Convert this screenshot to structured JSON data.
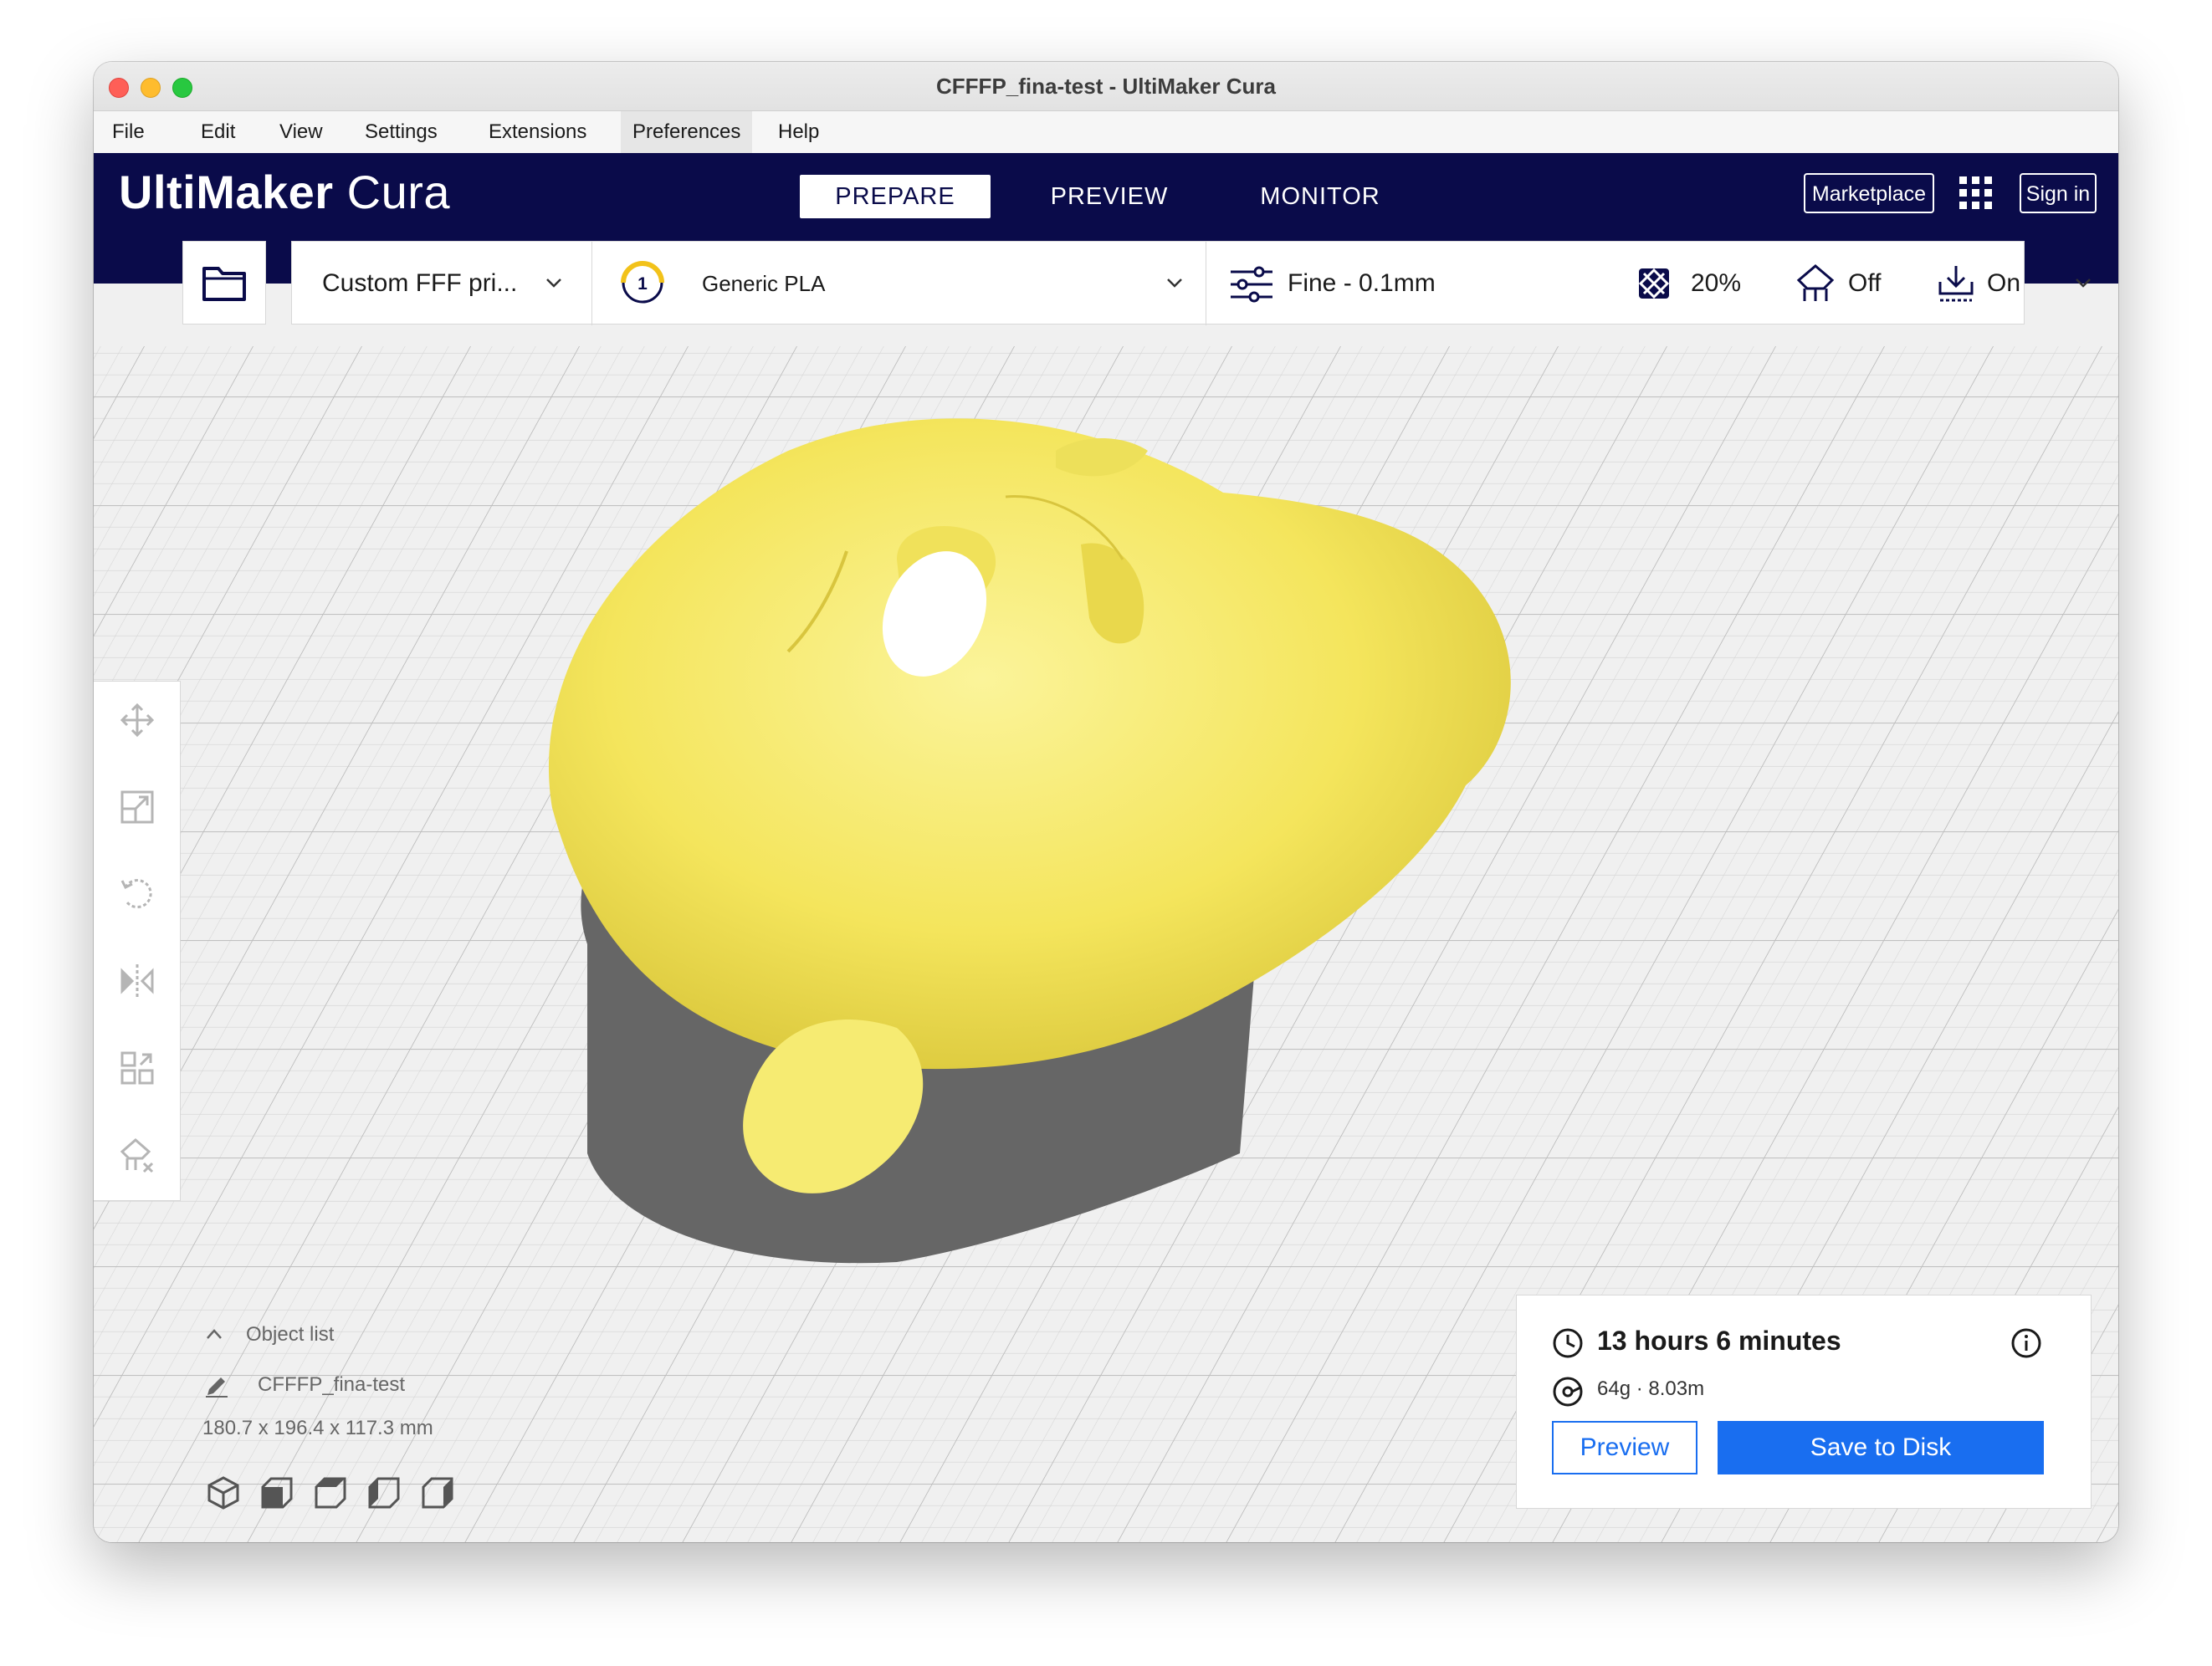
{
  "window": {
    "title": "CFFFP_fina-test - UltiMaker Cura"
  },
  "menu": [
    "File",
    "Edit",
    "View",
    "Settings",
    "Extensions",
    "Preferences",
    "Help"
  ],
  "header": {
    "logo_bold": "UltiMaker",
    "logo_light": "Cura",
    "stages": [
      "PREPARE",
      "PREVIEW",
      "MONITOR"
    ],
    "active_stage": "PREPARE",
    "marketplace_label": "Marketplace",
    "signin_label": "Sign in"
  },
  "config": {
    "printer": "Custom FFF pri...",
    "extruder_number": "1",
    "material": "Generic PLA",
    "profile": "Fine - 0.1mm",
    "infill": "20%",
    "support": "Off",
    "adhesion": "On"
  },
  "object_list": {
    "toggle_label": "Object list",
    "object_name": "CFFFP_fina-test",
    "dimensions": "180.7 x 196.4 x 117.3 mm"
  },
  "print_info": {
    "time": "13 hours 6 minutes",
    "material_usage": "64g · 8.03m",
    "preview_label": "Preview",
    "save_label": "Save to Disk"
  },
  "colors": {
    "header_bg": "#0a0b4a",
    "accent_blue": "#196ef0",
    "model_yellow": "#f7ec6e"
  },
  "icons": [
    "folder-icon",
    "sliders-icon",
    "infill-icon",
    "support-icon",
    "adhesion-icon",
    "move-icon",
    "scale-icon",
    "rotate-icon",
    "mirror-icon",
    "per-model-settings-icon",
    "support-blocker-icon",
    "clock-icon",
    "spool-icon",
    "info-icon",
    "pencil-icon",
    "chevron-up-icon",
    "view-cube-icons"
  ]
}
